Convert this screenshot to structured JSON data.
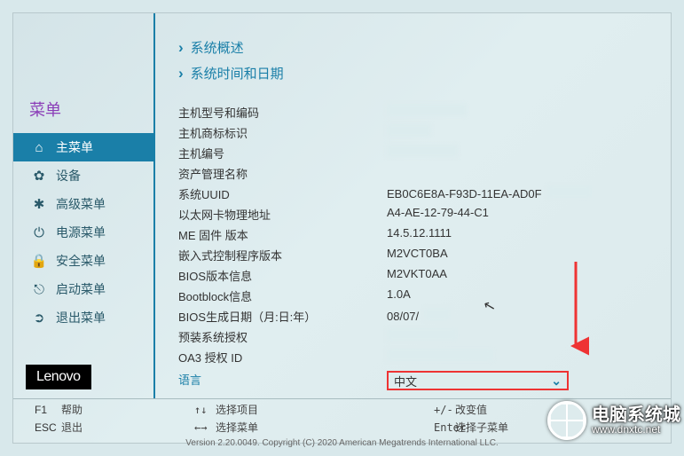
{
  "sidebar": {
    "title": "菜单",
    "items": [
      {
        "label": "主菜单",
        "icon": "⌂"
      },
      {
        "label": "设备",
        "icon": "✿"
      },
      {
        "label": "高级菜单",
        "icon": "✱"
      },
      {
        "label": "电源菜单",
        "icon": "⏻"
      },
      {
        "label": "安全菜单",
        "icon": "🔒"
      },
      {
        "label": "启动菜单",
        "icon": "⎋"
      },
      {
        "label": "退出菜单",
        "icon": "➲"
      }
    ],
    "logo": "Lenovo"
  },
  "main": {
    "sections": [
      {
        "label": "系统概述"
      },
      {
        "label": "系统时间和日期"
      }
    ],
    "rows": [
      {
        "label": "主机型号和编码",
        "value": "",
        "blur_w": 90
      },
      {
        "label": "主机商标标识",
        "value": "",
        "blur_w": 50
      },
      {
        "label": "主机编号",
        "value": "",
        "blur_w": 80
      },
      {
        "label": "资产管理名称",
        "value": ""
      },
      {
        "label": "系统UUID",
        "value": "EB0C6E8A-F93D-11EA-AD0F",
        "trail_blur": 50
      },
      {
        "label": "以太网卡物理地址",
        "value": "A4-AE-12-79-44-C1"
      },
      {
        "label": "ME 固件 版本",
        "value": "14.5.12.1111"
      },
      {
        "label": "嵌入式控制程序版本",
        "value": "M2VCT0BA"
      },
      {
        "label": "BIOS版本信息",
        "value": "M2VKT0AA"
      },
      {
        "label": "Bootblock信息",
        "value": "1.0A"
      },
      {
        "label": "BIOS生成日期（月:日:年）",
        "value": "08/07/",
        "trail_blur": 30
      },
      {
        "label": "预装系统授权",
        "value": "",
        "blur_w": 80
      },
      {
        "label": "OA3 授权 ID",
        "value": "",
        "blur_w": 120
      }
    ],
    "language": {
      "label": "语言",
      "value": "中文"
    }
  },
  "footer": {
    "help_key": "F1",
    "help_label": "帮助",
    "exit_key": "ESC",
    "exit_label": "退出",
    "select_item_keys": "↑↓",
    "select_item_label": "选择项目",
    "select_menu_keys": "←→",
    "select_menu_label": "选择菜单",
    "change_keys": "+/-",
    "change_label": "改变值",
    "enter_key": "Enter",
    "enter_label": "选择子菜单",
    "copyright": "Version 2.20.0049. Copyright (C) 2020 American Megatrends International LLC."
  },
  "watermark": {
    "title": "电脑系统城",
    "url": "www.dnxtc.net"
  }
}
